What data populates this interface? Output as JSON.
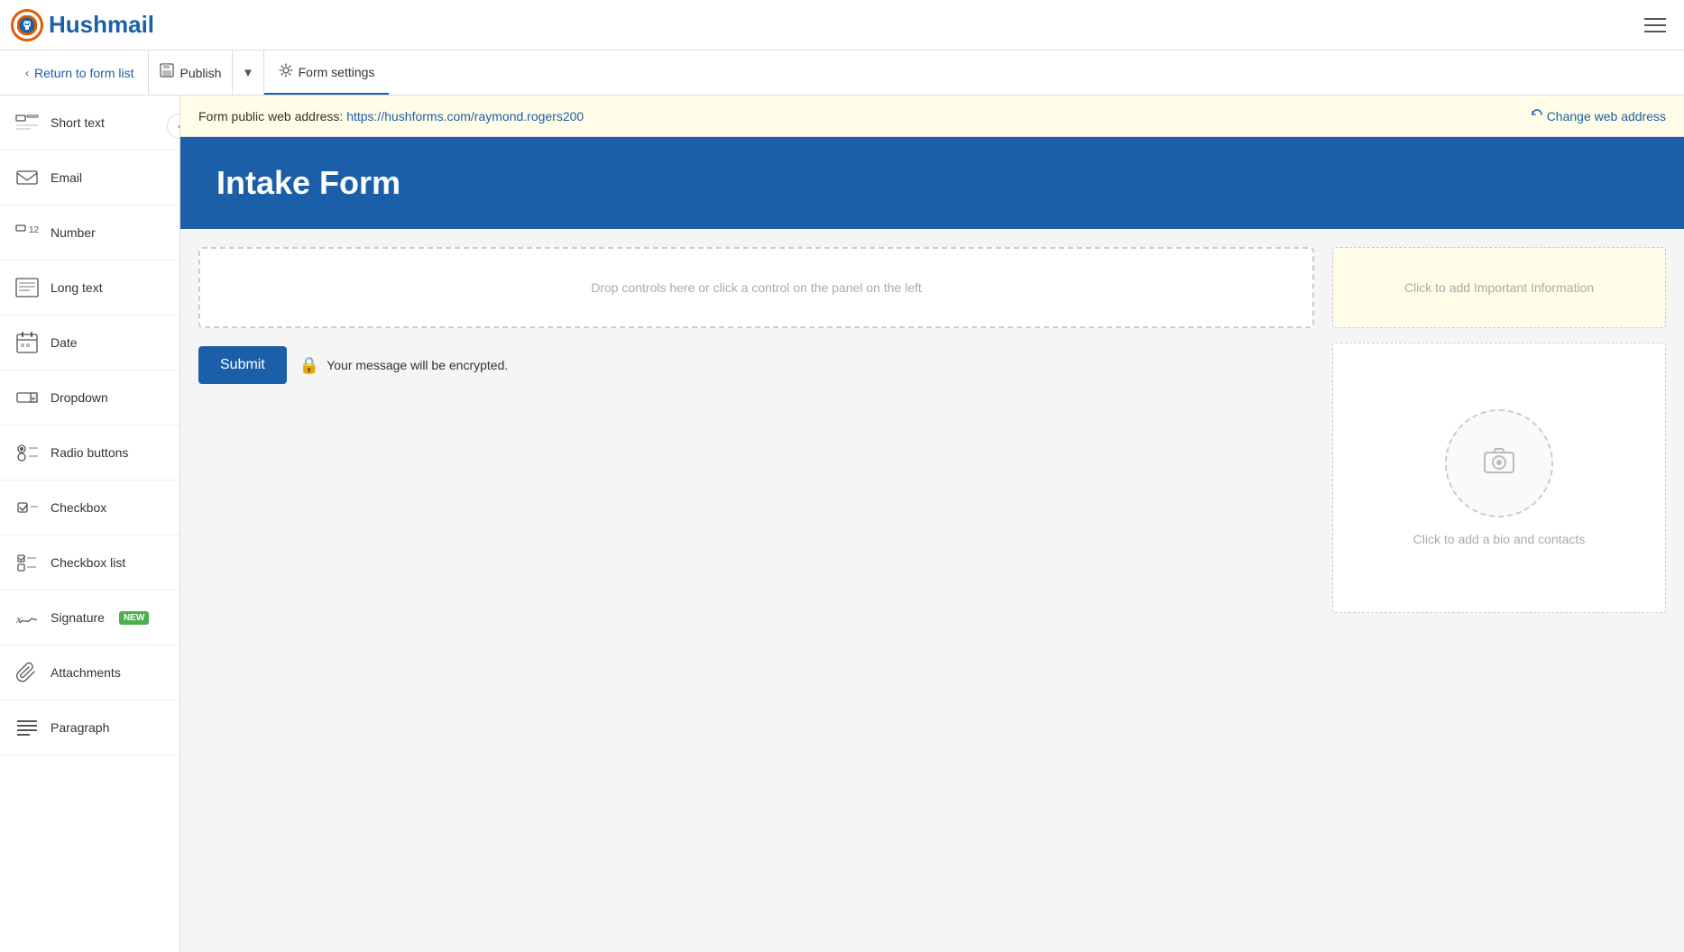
{
  "logo": {
    "text": "Hushmail",
    "icon_char": "🔒"
  },
  "action_bar": {
    "return_label": "Return to form list",
    "publish_label": "Publish",
    "form_settings_label": "Form settings"
  },
  "address_bar": {
    "label": "Form public web address:",
    "url": "https://hushforms.com/raymond.rogers200",
    "change_label": "Change web address"
  },
  "form": {
    "title": "Intake Form",
    "drop_zone_text": "Drop controls here or click a control on the panel on the left",
    "submit_label": "Submit",
    "encrypted_msg": "Your message will be encrypted.",
    "info_panel_text": "Click to add Important Information",
    "bio_panel_text": "Click to add a bio and contacts"
  },
  "sidebar": {
    "items": [
      {
        "id": "short-text",
        "label": "Short text",
        "icon": "short-text"
      },
      {
        "id": "email",
        "label": "Email",
        "icon": "email"
      },
      {
        "id": "number",
        "label": "Number",
        "icon": "number"
      },
      {
        "id": "long-text",
        "label": "Long text",
        "icon": "long-text"
      },
      {
        "id": "date",
        "label": "Date",
        "icon": "date"
      },
      {
        "id": "dropdown",
        "label": "Dropdown",
        "icon": "dropdown"
      },
      {
        "id": "radio-buttons",
        "label": "Radio buttons",
        "icon": "radio"
      },
      {
        "id": "checkbox",
        "label": "Checkbox",
        "icon": "checkbox"
      },
      {
        "id": "checkbox-list",
        "label": "Checkbox list",
        "icon": "checkbox-list"
      },
      {
        "id": "signature",
        "label": "Signature",
        "icon": "signature",
        "badge": "NEW"
      },
      {
        "id": "attachments",
        "label": "Attachments",
        "icon": "attachments"
      },
      {
        "id": "paragraph",
        "label": "Paragraph",
        "icon": "paragraph"
      }
    ]
  }
}
